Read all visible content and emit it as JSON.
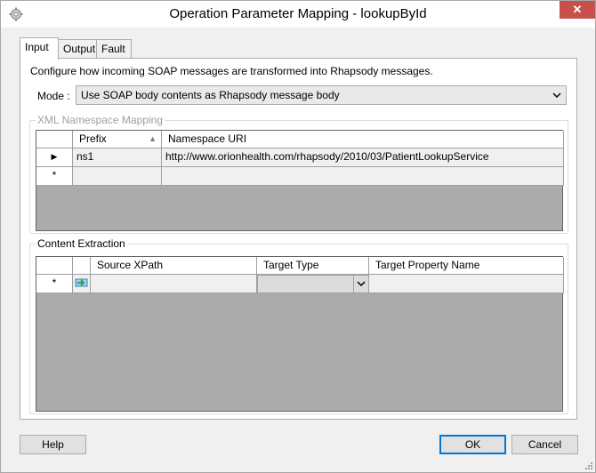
{
  "window": {
    "title": "Operation Parameter Mapping - lookupById",
    "close_glyph": "✕"
  },
  "tabs": [
    {
      "label": "Input",
      "active": true
    },
    {
      "label": "Output",
      "active": false
    },
    {
      "label": "Fault",
      "active": false
    }
  ],
  "input": {
    "description": "Configure how incoming SOAP messages are transformed into Rhapsody messages.",
    "mode_label": "Mode :",
    "mode_value": "Use SOAP body contents as Rhapsody message body"
  },
  "namespace_mapping": {
    "title": "XML Namespace Mapping",
    "columns": [
      "Prefix",
      "Namespace URI"
    ],
    "rows": [
      {
        "prefix": "ns1",
        "uri": "http://www.orionhealth.com/rhapsody/2010/03/PatientLookupService"
      }
    ],
    "new_row_marker": "*",
    "current_row_marker": "▶"
  },
  "content_extraction": {
    "title": "Content Extraction",
    "columns": [
      "Source XPath",
      "Target Type",
      "Target Property Name"
    ],
    "new_row_marker": "*"
  },
  "buttons": {
    "help": "Help",
    "ok": "OK",
    "cancel": "Cancel"
  }
}
